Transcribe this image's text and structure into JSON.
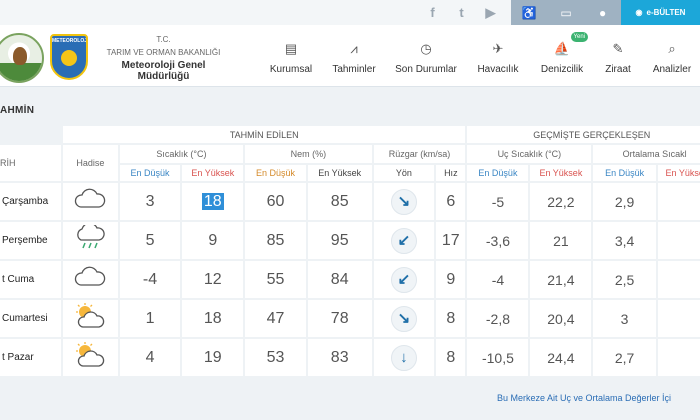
{
  "topbar": {
    "social": [
      "f",
      "t",
      "▶"
    ],
    "bulten_label": "e-BÜLTEN"
  },
  "header": {
    "org_line1": "T.C.",
    "org_line2": "TARIM VE ORMAN BAKANLIĞI",
    "org_line3": "Meteoroloji Genel Müdürlüğü",
    "logo2_text": "METEOROLOJI"
  },
  "nav": [
    {
      "label": "Kurumsal",
      "icon": "▤"
    },
    {
      "label": "Tahminler",
      "icon": "⩘"
    },
    {
      "label": "Son Durumlar",
      "icon": "◷"
    },
    {
      "label": "Havacılık",
      "icon": "✈"
    },
    {
      "label": "Denizcilik",
      "icon": "⛵",
      "badge": "Yeni"
    },
    {
      "label": "Ziraat",
      "icon": "✎"
    },
    {
      "label": "Analizler",
      "icon": "⌕"
    }
  ],
  "page_title": "AHMİN",
  "table": {
    "group_forecast": "TAHMİN EDİLEN",
    "group_past": "GEÇMİŞTE GERÇEKLEŞEN",
    "col_date": "RİH",
    "col_hadise": "Hadise",
    "col_temp": "Sıcaklık (°C)",
    "col_hum": "Nem (%)",
    "col_wind": "Rüzgar (km/sa)",
    "col_extreme": "Uç Sıcaklık (°C)",
    "col_avg": "Ortalama Sıcakl",
    "sub_low": "En Düşük",
    "sub_high": "En Yüksek",
    "sub_dir": "Yön",
    "sub_speed": "Hız",
    "rows": [
      {
        "day": "Çarşamba",
        "icon": "cloud",
        "tmin": "3",
        "tmax": "18",
        "hmin": "60",
        "hmax": "85",
        "dir": "↘",
        "speed": "6",
        "plow": "-5",
        "phigh": "22,2",
        "avglow": "2,9"
      },
      {
        "day": "Perşembe",
        "icon": "cloud-rain",
        "tmin": "5",
        "tmax": "9",
        "hmin": "85",
        "hmax": "95",
        "dir": "↙",
        "speed": "17",
        "plow": "-3,6",
        "phigh": "21",
        "avglow": "3,4"
      },
      {
        "day": "t Cuma",
        "icon": "cloud",
        "tmin": "-4",
        "tmax": "12",
        "hmin": "55",
        "hmax": "84",
        "dir": "↙",
        "speed": "9",
        "plow": "-4",
        "phigh": "21,4",
        "avglow": "2,5"
      },
      {
        "day": "Cumartesi",
        "icon": "partly-cloudy",
        "tmin": "1",
        "tmax": "18",
        "hmin": "47",
        "hmax": "78",
        "dir": "↘",
        "speed": "8",
        "plow": "-2,8",
        "phigh": "20,4",
        "avglow": "3"
      },
      {
        "day": "t Pazar",
        "icon": "partly-cloudy",
        "tmin": "4",
        "tmax": "19",
        "hmin": "53",
        "hmax": "83",
        "dir": "↓",
        "speed": "8",
        "plow": "-10,5",
        "phigh": "24,4",
        "avglow": "2,7"
      }
    ]
  },
  "footer_link": "Bu Merkeze Ait Uç ve Ortalama Değerler İçi"
}
